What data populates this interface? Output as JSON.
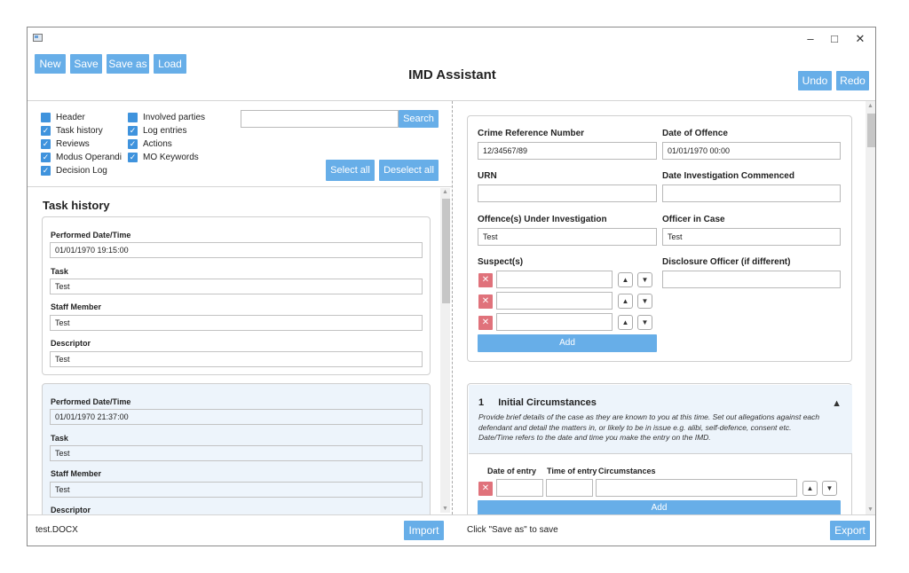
{
  "window": {
    "minimize_glyph": "–",
    "maximize_glyph": "□",
    "close_glyph": "✕",
    "app_icon": "app-window-icon"
  },
  "toolbar": {
    "new_label": "New",
    "save_label": "Save",
    "save_as_label": "Save as",
    "load_label": "Load",
    "undo_label": "Undo",
    "redo_label": "Redo"
  },
  "app_title": "IMD Assistant",
  "filters": {
    "items": [
      {
        "label": "Header",
        "checked": false
      },
      {
        "label": "Task history",
        "checked": true
      },
      {
        "label": "Reviews",
        "checked": true
      },
      {
        "label": "Modus Operandi",
        "checked": true
      },
      {
        "label": "Decision Log",
        "checked": true
      },
      {
        "label": "Involved parties",
        "checked": false
      },
      {
        "label": "Log entries",
        "checked": true
      },
      {
        "label": "Actions",
        "checked": true
      },
      {
        "label": "MO Keywords",
        "checked": true
      }
    ],
    "search_value": "",
    "search_label": "Search",
    "select_all_label": "Select all",
    "deselect_all_label": "Deselect all"
  },
  "task_history": {
    "title": "Task history",
    "entries": [
      {
        "performed_label": "Performed Date/Time",
        "performed_value": "01/01/1970 19:15:00",
        "task_label": "Task",
        "task_value": "Test",
        "staff_label": "Staff Member",
        "staff_value": "Test",
        "descriptor_label": "Descriptor",
        "descriptor_value": "Test"
      },
      {
        "performed_label": "Performed Date/Time",
        "performed_value": "01/01/1970 21:37:00",
        "task_label": "Task",
        "task_value": "Test",
        "staff_label": "Staff Member",
        "staff_value": "Test",
        "descriptor_label": "Descriptor"
      }
    ]
  },
  "form": {
    "crime_ref_label": "Crime Reference Number",
    "crime_ref_value": "12/34567/89",
    "date_offence_label": "Date of Offence",
    "date_offence_value": "01/01/1970 00:00",
    "urn_label": "URN",
    "urn_value": "",
    "date_commenced_label": "Date Investigation Commenced",
    "date_commenced_value": "",
    "offences_label": "Offence(s) Under Investigation",
    "offences_value": "Test",
    "officer_label": "Officer in Case",
    "officer_value": "Test",
    "suspects_label": "Suspect(s)",
    "suspects": [
      "",
      "",
      ""
    ],
    "disclosure_label": "Disclosure Officer (if different)",
    "disclosure_value": "",
    "add_label": "Add",
    "delete_glyph": "✕",
    "up_glyph": "▲",
    "down_glyph": "▼"
  },
  "circumstances": {
    "number": "1",
    "title": "Initial Circumstances",
    "description": "Provide brief details of the case as they are known to you at this time. Set out allegations against each defendant and detail the matters in, or likely to be in issue e.g. alibi, self-defence, consent etc. Date/Time refers to the date and time you make the entry on the IMD.",
    "collapse_glyph": "▲",
    "col_date": "Date of entry",
    "col_time": "Time of entry",
    "col_circ": "Circumstances",
    "add_label": "Add"
  },
  "footer": {
    "filename": "test.DOCX",
    "import_label": "Import",
    "status": "Click \"Save as\" to save",
    "export_label": "Export"
  }
}
